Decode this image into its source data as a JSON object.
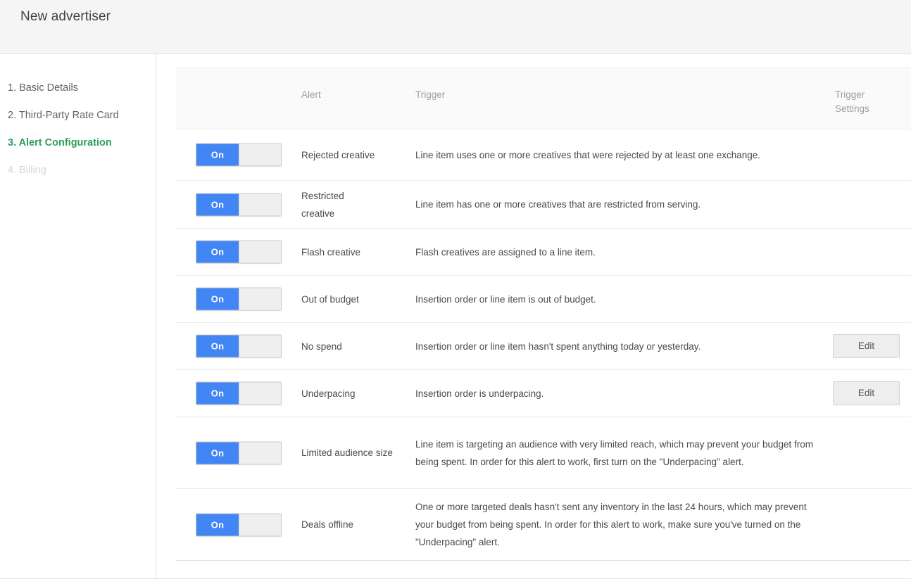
{
  "header": {
    "title": "New advertiser"
  },
  "sidebar": {
    "items": [
      {
        "label": "1. Basic Details",
        "state": "default"
      },
      {
        "label": "2. Third-Party Rate Card",
        "state": "default"
      },
      {
        "label": "3. Alert Configuration",
        "state": "active"
      },
      {
        "label": "4. Billing",
        "state": "disabled"
      }
    ]
  },
  "table": {
    "columns": {
      "toggle": "",
      "alert": "Alert",
      "trigger": "Trigger",
      "settings_line1": "Trigger",
      "settings_line2": "Settings"
    },
    "rows": [
      {
        "toggle_label": "On",
        "toggle_state": "On",
        "alert": "Rejected creative",
        "trigger": "Line item uses one or more creatives that were rejected by at least one exchange.",
        "settings_button": null
      },
      {
        "toggle_label": "On",
        "toggle_state": "On",
        "alert": "Restricted creative",
        "trigger": "Line item has one or more creatives that are restricted from serving.",
        "settings_button": null
      },
      {
        "toggle_label": "On",
        "toggle_state": "On",
        "alert": "Flash creative",
        "trigger": "Flash creatives are assigned to a line item.",
        "settings_button": null
      },
      {
        "toggle_label": "On",
        "toggle_state": "On",
        "alert": "Out of budget",
        "trigger": "Insertion order or line item is out of budget.",
        "settings_button": null
      },
      {
        "toggle_label": "On",
        "toggle_state": "On",
        "alert": "No spend",
        "trigger": "Insertion order or line item hasn't spent anything today or yesterday.",
        "settings_button": "Edit"
      },
      {
        "toggle_label": "On",
        "toggle_state": "On",
        "alert": "Underpacing",
        "trigger": "Insertion order is underpacing.",
        "settings_button": "Edit"
      },
      {
        "toggle_label": "On",
        "toggle_state": "On",
        "alert": "Limited audience size",
        "trigger": "Line item is targeting an audience with very limited reach, which may prevent your budget from being spent. In order for this alert to work, first turn on the \"Underpacing\" alert.",
        "settings_button": null
      },
      {
        "toggle_label": "On",
        "toggle_state": "On",
        "alert": "Deals offline",
        "trigger": "One or more targeted deals hasn't sent any inventory in the last 24 hours, which may prevent your budget from being spent. In order for this alert to work, make sure you've turned on the \"Underpacing\" alert.",
        "settings_button": null
      }
    ]
  },
  "colors": {
    "accent_green": "#2e9e5b",
    "toggle_on_blue": "#4285f4",
    "header_bg": "#f5f5f5",
    "table_head_bg": "#fafafa",
    "text_primary": "#4a4a4a",
    "text_muted": "#9e9e9e",
    "disabled": "#d6d6d6"
  }
}
